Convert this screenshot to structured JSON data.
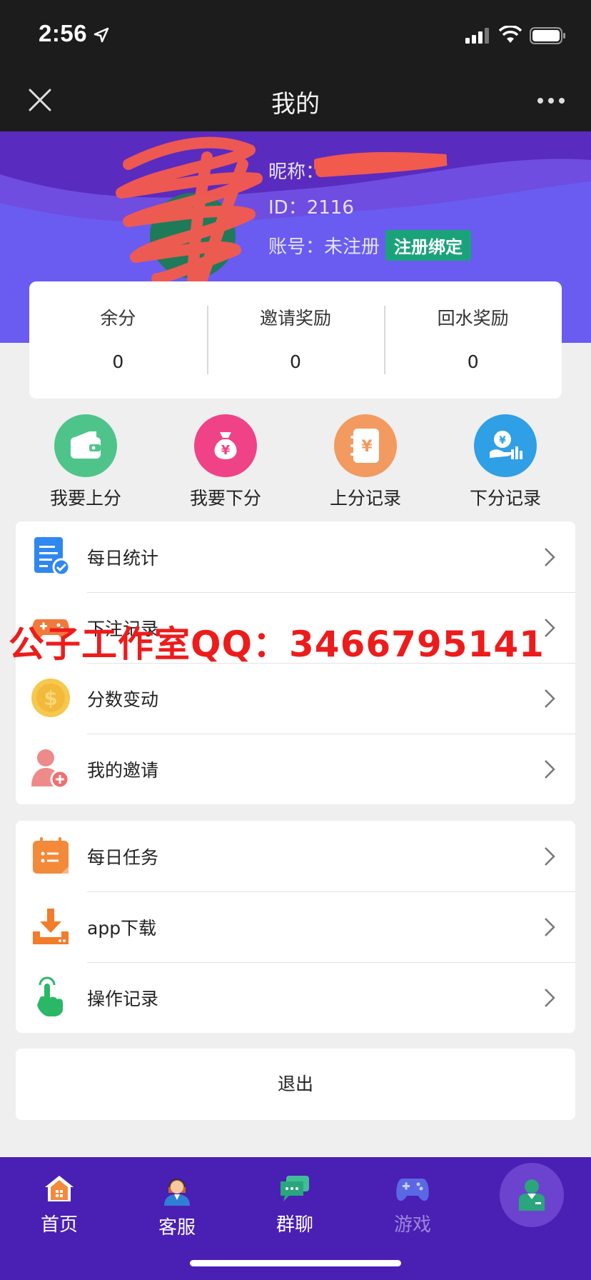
{
  "status_bar": {
    "time": "2:56"
  },
  "nav": {
    "title": "我的"
  },
  "profile": {
    "nickname_label": "昵称：",
    "id_line": "ID：2116",
    "account_line": "账号：未注册",
    "register_button": "注册绑定"
  },
  "balance": [
    {
      "label": "余分",
      "value": "0"
    },
    {
      "label": "邀请奖励",
      "value": "0"
    },
    {
      "label": "回水奖励",
      "value": "0"
    }
  ],
  "quick_actions": [
    {
      "label": "我要上分",
      "icon": "wallet-icon",
      "color": "#4fc48a"
    },
    {
      "label": "我要下分",
      "icon": "money-bag-icon",
      "color": "#f04287"
    },
    {
      "label": "上分记录",
      "icon": "ledger-icon",
      "color": "#f29a60"
    },
    {
      "label": "下分记录",
      "icon": "hand-coin-icon",
      "color": "#2f9fe6"
    }
  ],
  "menu_group_1": [
    {
      "label": "每日统计",
      "icon": "daily-stats-icon"
    },
    {
      "label": "下注记录",
      "icon": "gamepad-icon"
    },
    {
      "label": "分数变动",
      "icon": "coin-icon"
    },
    {
      "label": "我的邀请",
      "icon": "add-user-icon"
    }
  ],
  "menu_group_2": [
    {
      "label": "每日任务",
      "icon": "calendar-task-icon"
    },
    {
      "label": "app下载",
      "icon": "download-icon"
    },
    {
      "label": "操作记录",
      "icon": "tap-hand-icon"
    }
  ],
  "logout": "退出",
  "watermark": "公子工作室QQ：3466795141",
  "tabs": [
    {
      "label": "首页",
      "icon": "home-icon"
    },
    {
      "label": "客服",
      "icon": "support-agent-icon"
    },
    {
      "label": "群聊",
      "icon": "group-chat-icon"
    },
    {
      "label": "游戏",
      "icon": "game-icon"
    }
  ],
  "colors": {
    "banner": "#5a2bbf",
    "tabbar": "#4a1fb4",
    "register": "#1aa37a",
    "watermark": "#ee1b1b"
  }
}
